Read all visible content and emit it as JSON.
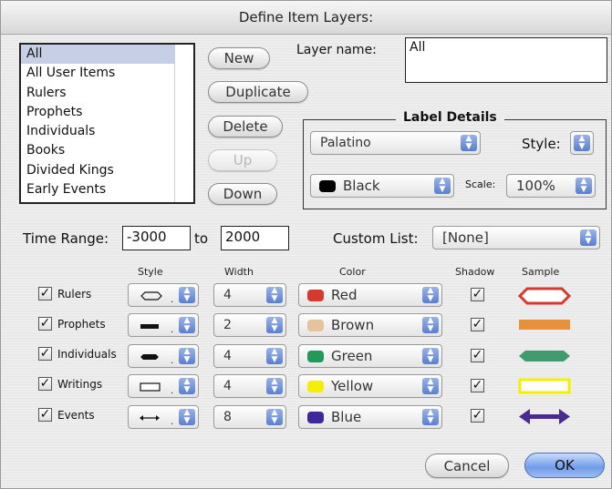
{
  "window": {
    "title": "Define Item Layers:"
  },
  "layer_list": {
    "items": [
      "All",
      "All User Items",
      "Rulers",
      "Prophets",
      "Individuals",
      "Books",
      "Divided Kings",
      "Early Events"
    ],
    "selected": "All"
  },
  "buttons": {
    "new": "New",
    "duplicate": "Duplicate",
    "delete": "Delete",
    "up": "Up",
    "down": "Down",
    "cancel": "Cancel",
    "ok": "OK"
  },
  "layer_name": {
    "label": "Layer name:",
    "value": "All"
  },
  "label_details": {
    "title": "Label Details",
    "font": "Palatino",
    "style_label": "Style:",
    "color": "Black",
    "color_hex": "#000000",
    "scale_label": "Scale:",
    "scale": "100%"
  },
  "time_range": {
    "label": "Time Range:",
    "from": "-3000",
    "to_label": "to",
    "to": "2000"
  },
  "custom_list": {
    "label": "Custom List:",
    "value": "[None]"
  },
  "columns": {
    "style": "Style",
    "width": "Width",
    "color": "Color",
    "shadow": "Shadow",
    "sample": "Sample"
  },
  "rows": [
    {
      "label": "Rulers",
      "checked": true,
      "width": "4",
      "color": "Red",
      "color_hex": "#d63a2e",
      "shadow": true,
      "style_glyph": "hexagon"
    },
    {
      "label": "Prophets",
      "checked": true,
      "width": "2",
      "color": "Brown",
      "color_hex": "#e5c49a",
      "shadow": true,
      "style_glyph": "bar"
    },
    {
      "label": "Individuals",
      "checked": true,
      "width": "4",
      "color": "Green",
      "color_hex": "#1f9a5a",
      "shadow": true,
      "style_glyph": "pointed-bar"
    },
    {
      "label": "Writings",
      "checked": true,
      "width": "4",
      "color": "Yellow",
      "color_hex": "#f2f000",
      "shadow": true,
      "style_glyph": "rectangle"
    },
    {
      "label": "Events",
      "checked": true,
      "width": "8",
      "color": "Blue",
      "color_hex": "#40289a",
      "shadow": true,
      "style_glyph": "double-arrow"
    }
  ]
}
